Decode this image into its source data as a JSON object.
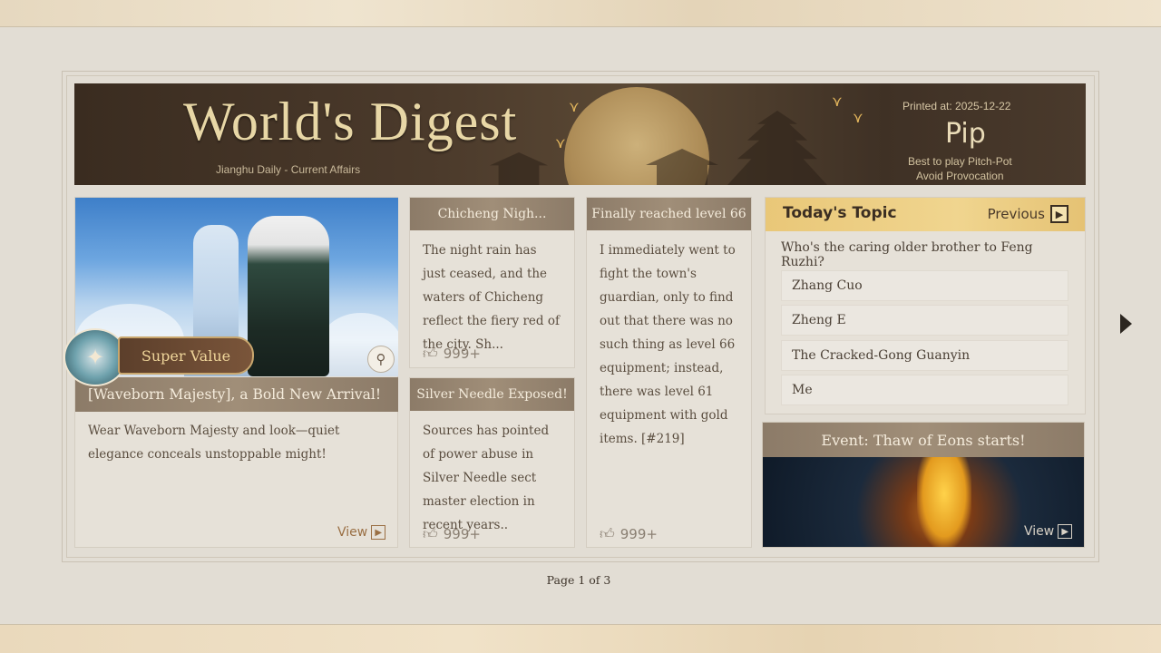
{
  "banner": {
    "title": "World's Digest",
    "subtitle": "Jianghu Daily - Current Affairs",
    "printed_at": "Printed at: 2025-12-22",
    "player_name": "Pip",
    "hint_line1": "Best to play Pitch-Pot",
    "hint_line2": "Avoid Provocation"
  },
  "feature": {
    "badge": "Super Value",
    "title": "[Waveborn Majesty], a Bold New Arrival!",
    "description": "Wear Waveborn Majesty and look—quiet elegance conceals unstoppable might!",
    "view_label": "View"
  },
  "articles": [
    {
      "title": "Chicheng Nigh...",
      "body": "The night rain has just ceased, and the waters of Chicheng reflect the fiery red of the city. Sh...",
      "likes": "999+"
    },
    {
      "title": "Silver Needle Exposed!",
      "body": "Sources has pointed of power abuse in Silver Needle sect master election in recent years..",
      "likes": "999+"
    },
    {
      "title": "Finally reached level 66",
      "body": "I immediately went to fight the town's guardian, only to find out that there was no such thing as level 66 equipment; instead, there was level 61 equipment with gold items. [#219]",
      "likes": "999+"
    }
  ],
  "topic": {
    "title": "Today's Topic",
    "previous_label": "Previous",
    "question": "Who's the caring older brother to Feng Ruzhi?",
    "options": [
      "Zhang Cuo",
      "Zheng E",
      "The Cracked-Gong Guanyin",
      "Me"
    ]
  },
  "event": {
    "title": "Event: Thaw of Eons starts!",
    "view_label": "View"
  },
  "pagination": {
    "label": "Page 1 of 3"
  },
  "colors": {
    "header_brown": "#8c7b68",
    "topic_gold": "#f0d58f",
    "paper": "#e2ddd4",
    "link": "#9a6f44"
  }
}
